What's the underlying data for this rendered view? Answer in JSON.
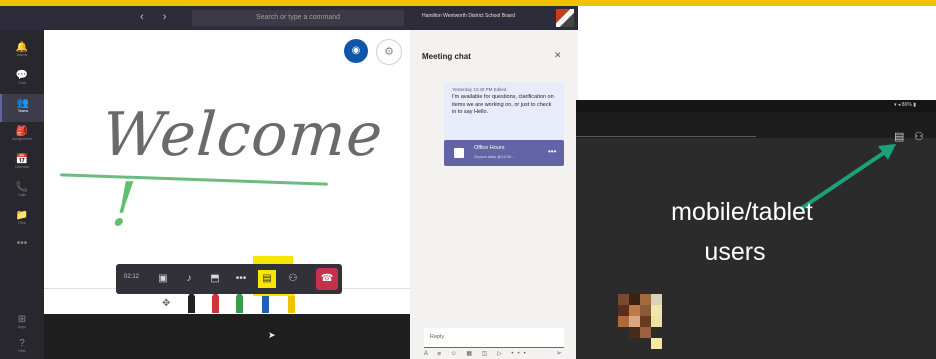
{
  "desktop": {
    "nav_arrows": "‹ ›",
    "search_placeholder": "Search or type a command",
    "org_name": "Hamilton Wentworth District School Board",
    "rail": [
      {
        "icon": "🔔",
        "label": "Activity"
      },
      {
        "icon": "💬",
        "label": "Chat"
      },
      {
        "icon": "👥",
        "label": "Teams"
      },
      {
        "icon": "🎒",
        "label": "Assignments"
      },
      {
        "icon": "📅",
        "label": "Calendar"
      },
      {
        "icon": "📞",
        "label": "Calls"
      },
      {
        "icon": "📁",
        "label": "Files"
      },
      {
        "icon": "•••",
        "label": ""
      }
    ],
    "rail_bottom": [
      {
        "icon": "⊞",
        "label": "Apps"
      },
      {
        "icon": "?",
        "label": "Help"
      }
    ],
    "whiteboard_text": "Welcome",
    "exclaim": "!",
    "call_timer": "02:12",
    "chat": {
      "title": "Meeting chat",
      "message_meta": "Yesterday 12:40 PM   Edited",
      "message_text": "I'm available for questions, clarification on items we are working on, or just to check in to say Hello.",
      "card_title": "Office Hours",
      "card_sub": "Occurs daily @11:00...",
      "reply_placeholder": "Reply"
    }
  },
  "mobile": {
    "status": "▾ ◂ 86% ▮",
    "caption_line1": "mobile/tablet",
    "caption_line2": "users"
  },
  "colors": {
    "accent": "#f2c200",
    "teams_purple": "#6264a7",
    "hangup": "#c4314b",
    "highlight": "#f7e600",
    "arrow": "#1aa37a"
  }
}
